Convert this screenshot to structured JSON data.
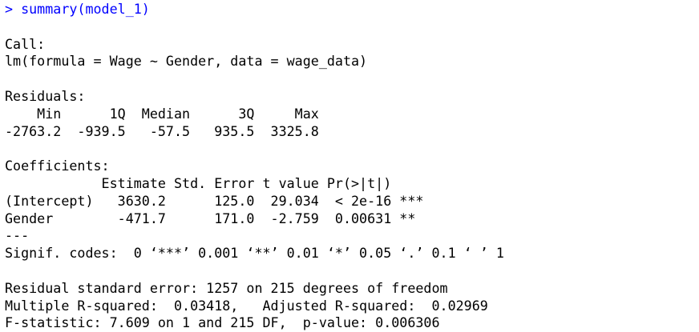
{
  "console": {
    "command_prompt": "> ",
    "command_text": "summary(model_1)",
    "call_header": "Call:",
    "call_formula": "lm(formula = Wage ~ Gender, data = wage_data)",
    "residuals_header": "Residuals:",
    "residuals_columns_line": "    Min      1Q  Median      3Q     Max ",
    "residuals_values_line": "-2763.2  -939.5   -57.5   935.5  3325.8 ",
    "coefficients_header": "Coefficients:",
    "coefficients_columns_line": "            Estimate Std. Error t value Pr(>|t|)    ",
    "coefficients_row_intercept": "(Intercept)   3630.2      125.0  29.034  < 2e-16 ***",
    "coefficients_row_gender": "Gender        -471.7      171.0  -2.759  0.00631 ** ",
    "separator": "---",
    "signif_codes": "Signif. codes:  0 ‘***’ 0.001 ‘**’ 0.01 ‘*’ 0.05 ‘.’ 0.1 ‘ ’ 1",
    "residual_standard_error": "Residual standard error: 1257 on 215 degrees of freedom",
    "r_squared": "Multiple R-squared:  0.03418,\tAdjusted R-squared:  0.02969 ",
    "f_statistic": "F-statistic: 7.609 on 1 and 215 DF,  p-value: 0.006306"
  },
  "colors": {
    "command": "#0000ff",
    "output": "#000000",
    "background": "#ffffff"
  }
}
